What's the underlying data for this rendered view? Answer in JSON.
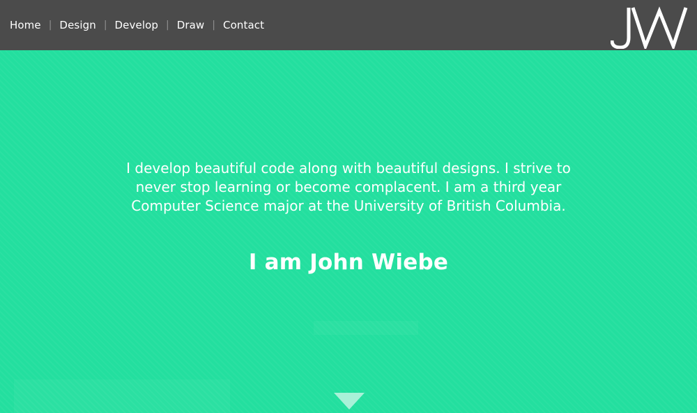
{
  "nav": {
    "items": [
      {
        "label": "Home"
      },
      {
        "label": "Design"
      },
      {
        "label": "Develop"
      },
      {
        "label": "Draw"
      },
      {
        "label": "Contact"
      }
    ],
    "separator": "|"
  },
  "logo": {
    "text": "JW",
    "icon": "jw-monogram-logo"
  },
  "hero": {
    "intro": "I develop beautiful code along with beautiful designs. I strive to never stop learning or become complacent. I am a third year Computer Science major at the University of British Columbia.",
    "name": "I am John Wiebe",
    "background_color": "#23df9f",
    "scroll_icon": "triangle-down-icon"
  },
  "colors": {
    "navbar": "#4b4b4b",
    "accent": "#23df9f",
    "text": "#ffffff"
  }
}
